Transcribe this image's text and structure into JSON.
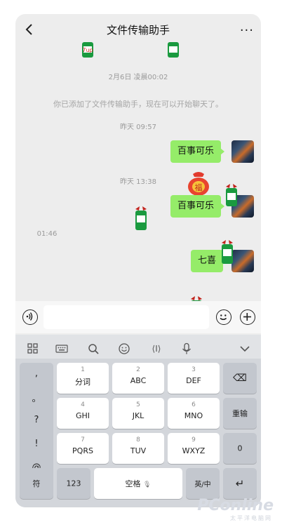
{
  "header": {
    "title": "文件传输助手",
    "more": "···"
  },
  "chat": {
    "timestamp1": "2月6日 凌晨00:02",
    "system_note": "你已添加了文件传输助手，现在可以开始聊天了。",
    "timestamp2": "昨天 09:57",
    "msg1": "百事可乐",
    "timestamp3": "昨天 13:38",
    "msg2": "百事可乐",
    "timestamp4": "01:46",
    "msg3": "七喜",
    "sticker_char": "福",
    "can_brand": "7up"
  },
  "toolbar": {
    "cursor_label": "⟨I⟩"
  },
  "keyboard": {
    "punct": [
      ",",
      "。",
      "?",
      "!",
      "@"
    ],
    "row1": [
      {
        "num": "1",
        "label": "分词"
      },
      {
        "num": "2",
        "label": "ABC"
      },
      {
        "num": "3",
        "label": "DEF"
      }
    ],
    "row2": [
      {
        "num": "4",
        "label": "GHI"
      },
      {
        "num": "5",
        "label": "JKL"
      },
      {
        "num": "6",
        "label": "MNO"
      }
    ],
    "row3": [
      {
        "num": "7",
        "label": "PQRS"
      },
      {
        "num": "8",
        "label": "TUV"
      },
      {
        "num": "9",
        "label": "WXYZ"
      }
    ],
    "backspace": "⌫",
    "newline": "重输",
    "zero": "0",
    "symbol": "符",
    "num_mode": "123",
    "space": "空格",
    "lang": "英/中",
    "enter": "↵"
  },
  "watermark": {
    "brand": "PConline",
    "sub": "太平洋电脑网"
  }
}
